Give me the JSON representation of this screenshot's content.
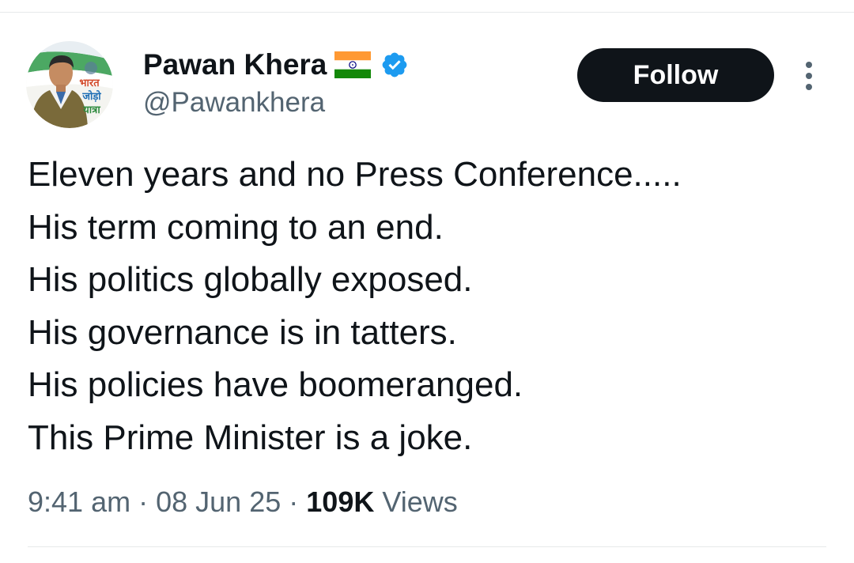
{
  "author": {
    "display_name": "Pawan Khera",
    "handle": "@Pawankhera",
    "flag_icon": "india-flag-icon",
    "verified_icon": "verified-badge-icon",
    "verified_color": "#1d9bf0",
    "avatar_text": [
      "भारत",
      "जोड़ो",
      "यात्रा"
    ]
  },
  "follow_button": {
    "label": "Follow"
  },
  "more_menu": {
    "icon": "more-vertical-icon"
  },
  "tweet": {
    "lines": [
      "Eleven years and no Press Conference.....",
      "His term coming to an end.",
      "His politics globally exposed.",
      "His governance is in tatters.",
      "His policies have boomeranged.",
      "This Prime Minister is a joke."
    ]
  },
  "meta": {
    "time": "9:41 am",
    "separator": "·",
    "date": "08 Jun 25",
    "views_count": "109K",
    "views_label": "Views"
  }
}
